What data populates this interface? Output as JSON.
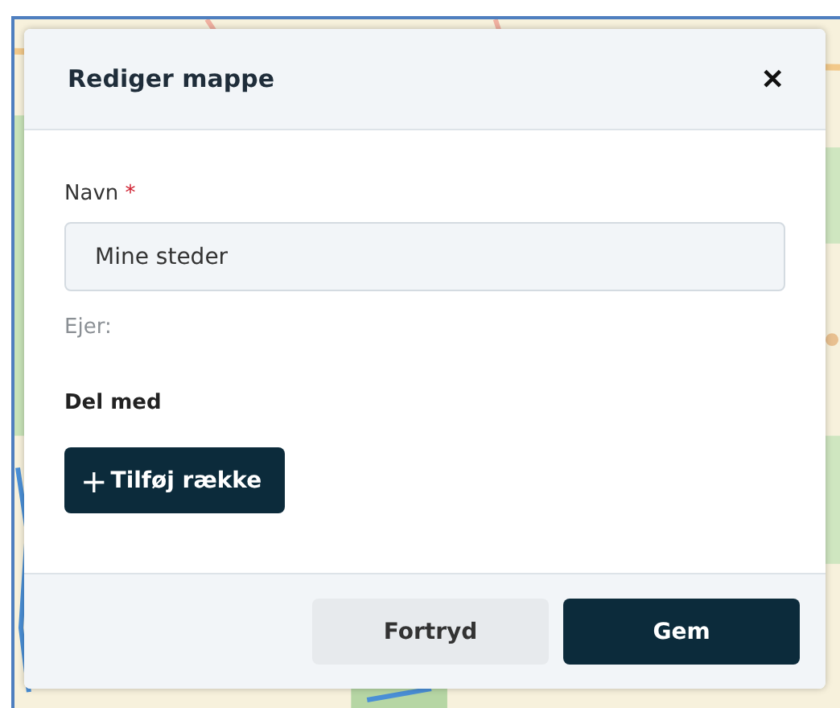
{
  "dialog": {
    "title": "Rediger mappe",
    "close": "✕",
    "name_field": {
      "label": "Navn",
      "required_mark": "*",
      "value": "Mine steder"
    },
    "owner_label": "Ejer:",
    "share_heading": "Del med",
    "add_row_button": {
      "icon": "+",
      "label": "Tilføj række"
    },
    "buttons": [
      {
        "label": "Fortryd",
        "kind": "secondary"
      },
      {
        "label": "Gem",
        "kind": "primary"
      }
    ]
  }
}
